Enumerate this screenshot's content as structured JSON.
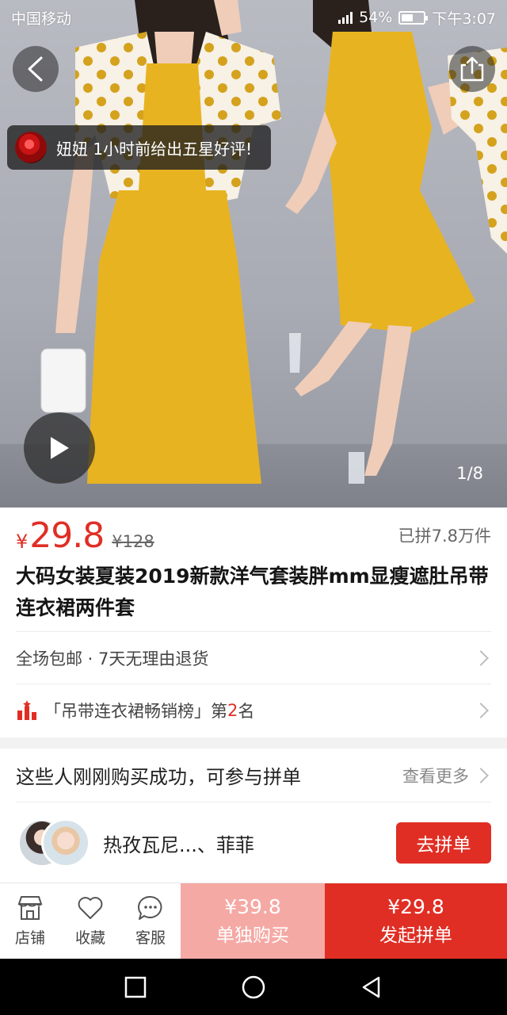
{
  "status": {
    "carrier": "中国移动",
    "battery": "54%",
    "battery_level": 0.54,
    "time": "下午3:07"
  },
  "hero": {
    "toast": "妞妞 1小时前给出五星好评!",
    "pager": "1/8",
    "colors": {
      "dress": "#e8b321",
      "dots": "#d4a21c"
    }
  },
  "product": {
    "currency": "¥",
    "price": "29.8",
    "original_price": "¥128",
    "sold": "已拼7.8万件",
    "title": "大码女装夏装2019新款洋气套装胖mm显瘦遮肚吊带连衣裙两件套"
  },
  "service": {
    "text": "全场包邮 · 7天无理由退货"
  },
  "ranking": {
    "prefix": "「吊带连衣裙畅销榜」第",
    "rank": "2",
    "suffix": "名"
  },
  "buyers": {
    "heading": "这些人刚刚购买成功，可参与拼单",
    "more": "查看更多",
    "names": "热孜瓦尼...、菲菲",
    "join_label": "去拼单"
  },
  "bottom_bar": {
    "tabs": [
      {
        "label": "店铺",
        "icon": "store-icon"
      },
      {
        "label": "收藏",
        "icon": "heart-icon"
      },
      {
        "label": "客服",
        "icon": "chat-icon"
      }
    ],
    "single": {
      "price": "¥39.8",
      "label": "单独购买"
    },
    "group": {
      "price": "¥29.8",
      "label": "发起拼单"
    }
  },
  "accent": "#e02e24"
}
